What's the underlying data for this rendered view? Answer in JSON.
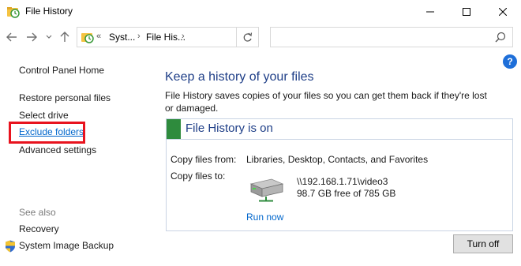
{
  "window": {
    "title": "File History",
    "minimize_icon": "minimize-icon",
    "maximize_icon": "maximize-icon",
    "close_icon": "close-icon"
  },
  "navbar": {
    "address": {
      "overflow": "«",
      "crumbs": [
        "Syst...",
        "File His..."
      ],
      "separator": "›"
    },
    "search_placeholder": ""
  },
  "help": {
    "label": "?"
  },
  "sidebar": {
    "home": "Control Panel Home",
    "items": [
      "Restore personal files",
      "Select drive",
      "Exclude folders",
      "Advanced settings"
    ],
    "see_also_label": "See also",
    "see_also": [
      "Recovery",
      "System Image Backup"
    ]
  },
  "main": {
    "heading": "Keep a history of your files",
    "description": "File History saves copies of your files so you can get them back if they're lost or damaged.",
    "status": {
      "title": "File History is on",
      "status_color": "#2e8b3d",
      "copy_from_label": "Copy files from:",
      "copy_from_value": "Libraries, Desktop, Contacts, and Favorites",
      "copy_to_label": "Copy files to:",
      "drive_path": "\\\\192.168.1.71\\video3",
      "drive_free": "98.7 GB free of 785 GB",
      "run_now": "Run now"
    },
    "turn_off": "Turn off"
  },
  "colors": {
    "link": "#0066cc",
    "heading": "#1e3e87",
    "highlight": "#e8131e"
  }
}
